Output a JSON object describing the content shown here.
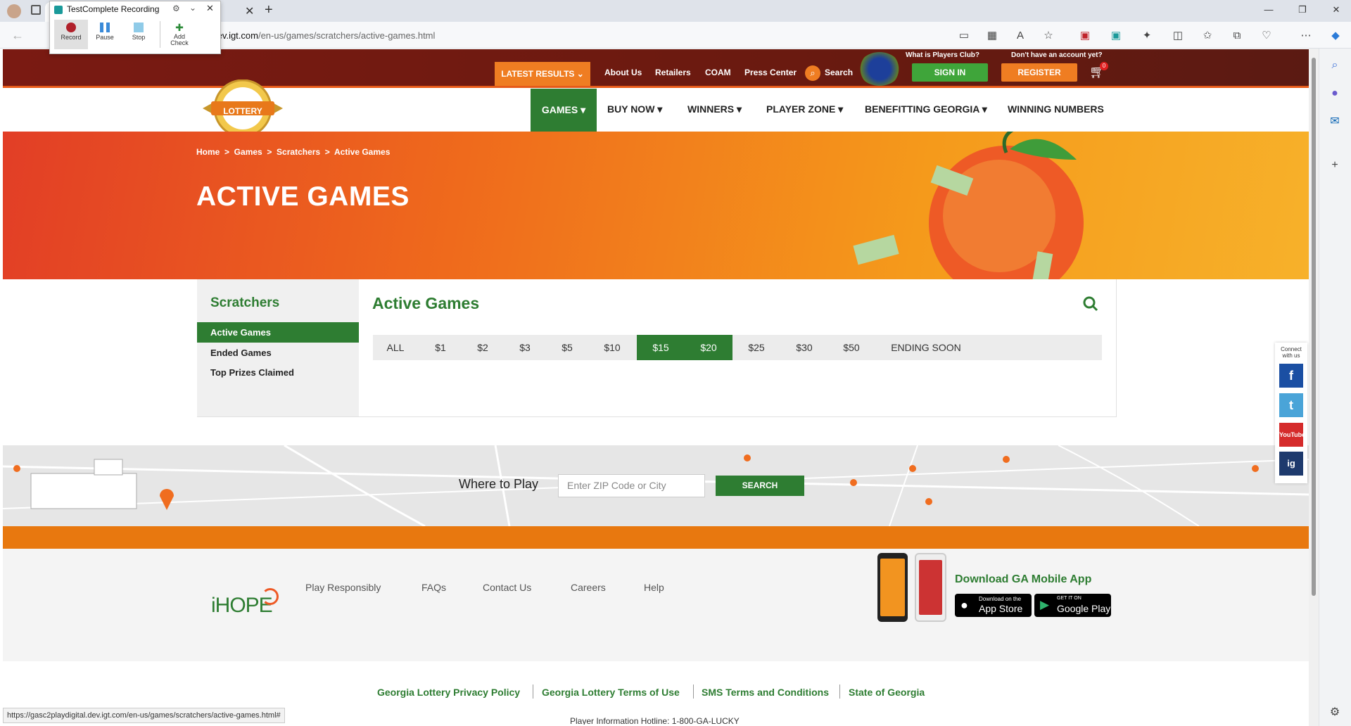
{
  "browser": {
    "url_host": "gital.dev.igt.com",
    "url_path": "/en-us/games/scratchers/active-games.html",
    "status_url": "https://gasc2playdigital.dev.igt.com/en-us/games/scratchers/active-games.html#"
  },
  "recorder": {
    "title": "TestComplete Recording",
    "buttons": [
      "Record",
      "Pause",
      "Stop",
      "Add Check"
    ]
  },
  "header": {
    "latest_results": "LATEST RESULTS",
    "links": [
      "About Us",
      "Retailers",
      "COAM",
      "Press Center"
    ],
    "search": "Search",
    "players_club_q": "What is Players Club?",
    "account_q": "Don't have an account yet?",
    "sign_in": "SIGN IN",
    "register": "REGISTER",
    "cart_count": "0"
  },
  "logo": {
    "text": "LOTTERY"
  },
  "nav": {
    "items": [
      "GAMES",
      "BUY NOW",
      "WINNERS",
      "PLAYER ZONE",
      "BENEFITTING GEORGIA",
      "WINNING NUMBERS"
    ]
  },
  "hero": {
    "breadcrumb": "Home  >  Games  >  Scratchers  >  Active Games",
    "title": "ACTIVE GAMES"
  },
  "sidebar": {
    "heading": "Scratchers",
    "items": [
      "Active Games",
      "Ended Games",
      "Top Prizes Claimed"
    ]
  },
  "main": {
    "heading": "Active Games",
    "filters": [
      "ALL",
      "$1",
      "$2",
      "$3",
      "$5",
      "$10",
      "$15",
      "$20",
      "$25",
      "$30",
      "$50",
      "ENDING SOON"
    ],
    "active_filters": [
      "$15",
      "$20"
    ]
  },
  "where_to_play": {
    "label": "Where to Play",
    "placeholder": "Enter ZIP Code or City",
    "button": "SEARCH"
  },
  "footer": {
    "links": [
      "Play Responsibly",
      "FAQs",
      "Contact Us",
      "Careers",
      "Help"
    ],
    "app_heading": "Download GA Mobile App",
    "app_store_small": "Download on the",
    "app_store": "App Store",
    "google_small": "GET IT ON",
    "google": "Google Play",
    "ihope": "iHOPE",
    "legal": [
      "Georgia Lottery Privacy Policy",
      "Georgia Lottery Terms of Use",
      "SMS Terms and Conditions",
      "State of Georgia"
    ],
    "hotline": "Player Information Hotline: 1-800-GA-LUCKY"
  },
  "social": {
    "label": "Connect with us",
    "items": [
      "f",
      "t",
      "YouTube",
      "ig"
    ]
  },
  "colors": {
    "green": "#2e7d32",
    "orange": "#ef7d22",
    "maroon": "#6a1a10"
  }
}
